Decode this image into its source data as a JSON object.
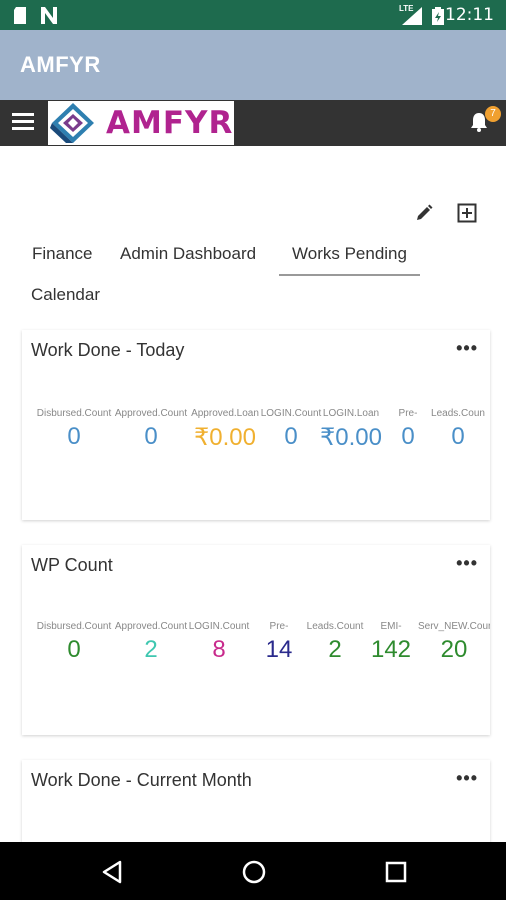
{
  "status_bar": {
    "time": "12:11",
    "network": "LTE"
  },
  "app_bar": {
    "title": "AMFYR"
  },
  "nav": {
    "logo_text": "AMFYR",
    "notification_count": "7"
  },
  "tabs": [
    {
      "label": "Finance",
      "active": false
    },
    {
      "label": "Admin Dashboard",
      "active": false
    },
    {
      "label": "Works Pending",
      "active": true
    },
    {
      "label": "Calendar",
      "active": false
    }
  ],
  "cards": [
    {
      "title": "Work Done - Today",
      "more": "•••",
      "stats": [
        {
          "label": "Disbursed.Count",
          "value": "0",
          "color": "#4a8fc8"
        },
        {
          "label": "Approved.Count",
          "value": "0",
          "color": "#4a8fc8"
        },
        {
          "label": "Approved.Loan",
          "value": "₹0.00",
          "color": "#f0b030"
        },
        {
          "label": "LOGIN.Count",
          "value": "0",
          "color": "#4a8fc8"
        },
        {
          "label": "LOGIN.Loan",
          "value": "₹0.00",
          "color": "#4a8fc8"
        },
        {
          "label": "Pre-",
          "value": "0",
          "color": "#4a8fc8"
        },
        {
          "label": "Leads.Coun",
          "value": "0",
          "color": "#4a8fc8"
        }
      ]
    },
    {
      "title": "WP Count",
      "more": "•••",
      "stats": [
        {
          "label": "Disbursed.Count",
          "value": "0",
          "color": "#2e8b2e"
        },
        {
          "label": "Approved.Count",
          "value": "2",
          "color": "#3fc7b0"
        },
        {
          "label": "LOGIN.Count",
          "value": "8",
          "color": "#c82a8c"
        },
        {
          "label": "Pre-",
          "value": "14",
          "color": "#2a2a8c"
        },
        {
          "label": "Leads.Count",
          "value": "2",
          "color": "#2e8b2e"
        },
        {
          "label": "EMI-",
          "value": "142",
          "color": "#2e8b2e"
        },
        {
          "label": "Serv_NEW.Cour",
          "value": "20",
          "color": "#2e8b2e"
        }
      ]
    },
    {
      "title": "Work Done - Current Month",
      "more": "•••",
      "stats": []
    }
  ]
}
